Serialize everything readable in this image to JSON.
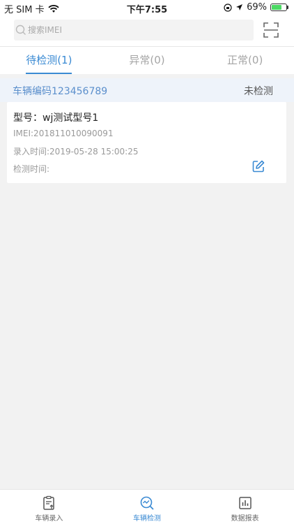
{
  "status_bar": {
    "carrier": "无 SIM 卡",
    "time": "下午7:55",
    "battery_text": "69%",
    "battery_level": 0.69,
    "battery_color": "#4cd964"
  },
  "search": {
    "placeholder": "搜索IMEI",
    "value": "",
    "icons": {
      "search": "search-icon",
      "scan": "scan-icon"
    }
  },
  "tabs": [
    {
      "label": "待检测(1)",
      "active": true
    },
    {
      "label": "异常(0)",
      "active": false
    },
    {
      "label": "正常(0)",
      "active": false
    }
  ],
  "vehicle": {
    "code": "车辆编码123456789",
    "status": "未检测"
  },
  "card": {
    "model": "型号：wj测试型号1",
    "imei": "IMEI:201811010090091",
    "entry_time": "录入时间:2019-05-28 15:00:25",
    "check_time": "检测时间:",
    "icon": "edit-icon"
  },
  "bottom_nav": [
    {
      "label": "车辆录入",
      "icon": "clipboard-upload-icon",
      "active": false
    },
    {
      "label": "车辆检测",
      "icon": "search-chart-icon",
      "active": true
    },
    {
      "label": "数据报表",
      "icon": "bar-chart-icon",
      "active": false
    }
  ],
  "colors": {
    "accent": "#3a8ad3",
    "vehicle_header_bg": "#eef3fa",
    "vehicle_code": "#5b8fcc",
    "page_bg": "#f2f2f2"
  }
}
